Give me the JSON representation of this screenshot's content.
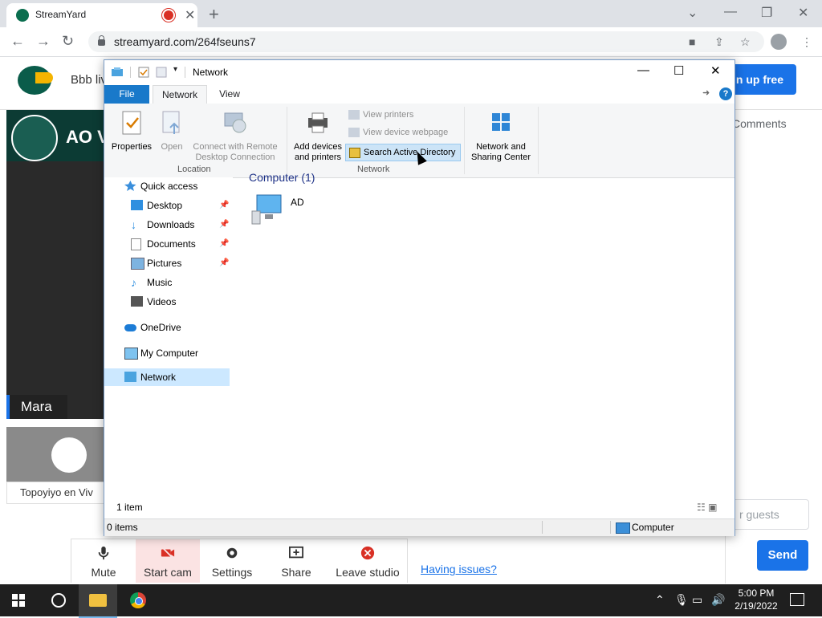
{
  "browser": {
    "tab_title": "StreamYard",
    "new_tab": "+",
    "url": "streamyard.com/264fseuns7"
  },
  "streamyard": {
    "broadcast_title": "Bbb liv",
    "signup": "gn up free",
    "stage_banner": "AO V",
    "host_name": "Mara",
    "guest_name": "Topoyiyo en Viv",
    "comments_tab": "Comments",
    "guest_input_placeholder": "r guests",
    "send": "Send",
    "controls": [
      "Mute",
      "Start cam",
      "Settings",
      "Share",
      "Leave studio"
    ],
    "issues_link": "Having issues?"
  },
  "explorer": {
    "title": "Network",
    "tabs": {
      "file": "File",
      "network": "Network",
      "view": "View"
    },
    "ribbon": {
      "properties": "Properties",
      "open": "Open",
      "connect_remote_1": "Connect with Remote",
      "connect_remote_2": "Desktop Connection",
      "add_devices_1": "Add devices",
      "add_devices_2": "and printers",
      "view_printers": "View printers",
      "view_device_webpage": "View device webpage",
      "search_ad": "Search Active Directory",
      "network_sharing_1": "Network and",
      "network_sharing_2": "Sharing Center",
      "group_location": "Location",
      "group_network": "Network"
    },
    "nav": {
      "quick_access": "Quick access",
      "desktop": "Desktop",
      "downloads": "Downloads",
      "documents": "Documents",
      "pictures": "Pictures",
      "music": "Music",
      "videos": "Videos",
      "onedrive": "OneDrive",
      "my_computer": "My Computer",
      "network": "Network"
    },
    "group_header": "Computer (1)",
    "item_label": "AD",
    "item_count": "1 item",
    "status_left": "0 items",
    "status_right": "Computer"
  },
  "taskbar": {
    "time": "5:00 PM",
    "date": "2/19/2022"
  }
}
